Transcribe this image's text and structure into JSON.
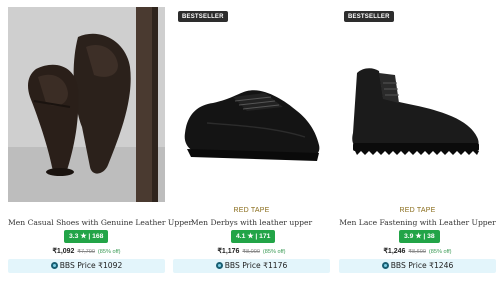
{
  "products": [
    {
      "badge": "",
      "brand": "",
      "name": "Men Casual Shoes with Genuine Leather Upper",
      "rating": "3.3 ★ | 168",
      "price": "₹1,092",
      "mrp": "₹7,700",
      "discount": "(85% off)",
      "bbs_label": "BBS Price ₹1092",
      "image_icon": "loafer-shoe-photo"
    },
    {
      "badge": "BESTSELLER",
      "brand": "RED TAPE",
      "name": "Men Derbys with leather upper",
      "rating": "4.1 ★ | 171",
      "price": "₹1,176",
      "mrp": "₹8,000",
      "discount": "(85% off)",
      "bbs_label": "BBS Price ₹1176",
      "image_icon": "derby-shoe-photo"
    },
    {
      "badge": "BESTSELLER",
      "brand": "RED TAPE",
      "name": "Men Lace Fastening with Leather Upper",
      "rating": "3.9 ★ | 38",
      "price": "₹1,246",
      "mrp": "₹8,600",
      "discount": "(85% off)",
      "bbs_label": "BBS Price ₹1246",
      "image_icon": "boot-shoe-photo"
    }
  ],
  "colors": {
    "rating_bg": "#22a447",
    "brand_text": "#8a6d1c",
    "bbs_bg": "#e3f5fb",
    "badge_bg": "#2d2d2d"
  }
}
